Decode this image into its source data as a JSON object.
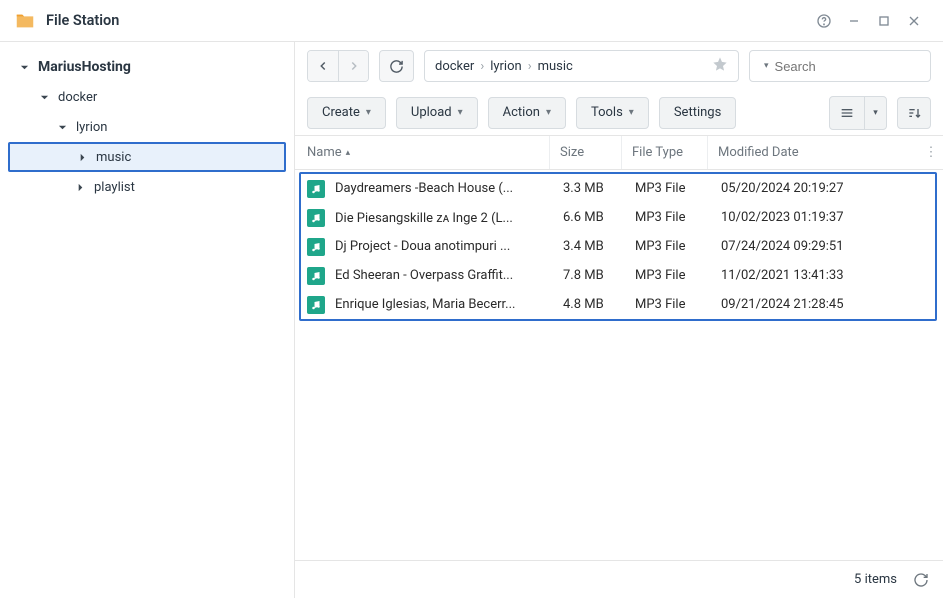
{
  "app": {
    "title": "File Station"
  },
  "tree": {
    "root": "MariusHosting",
    "items": [
      {
        "label": "docker",
        "depth": 1,
        "expanded": true
      },
      {
        "label": "lyrion",
        "depth": 2,
        "expanded": true
      },
      {
        "label": "music",
        "depth": 3,
        "expanded": false,
        "selected": true
      },
      {
        "label": "playlist",
        "depth": 3,
        "expanded": false
      }
    ]
  },
  "breadcrumb": [
    "docker",
    "lyrion",
    "music"
  ],
  "search": {
    "placeholder": "Search"
  },
  "toolbar": {
    "create": "Create",
    "upload": "Upload",
    "action": "Action",
    "tools": "Tools",
    "settings": "Settings"
  },
  "columns": {
    "name": "Name",
    "size": "Size",
    "type": "File Type",
    "date": "Modified Date"
  },
  "files": [
    {
      "name": "Daydreamers -Beach House (...",
      "size": "3.3 MB",
      "type": "MP3 File",
      "date": "05/20/2024 20:19:27"
    },
    {
      "name": "Die Piesangskille ᴢᴀ Inge 2 (L...",
      "size": "6.6 MB",
      "type": "MP3 File",
      "date": "10/02/2023 01:19:37"
    },
    {
      "name": "Dj Project - Doua anotimpuri ...",
      "size": "3.4 MB",
      "type": "MP3 File",
      "date": "07/24/2024 09:29:51"
    },
    {
      "name": "Ed Sheeran - Overpass Graffit...",
      "size": "7.8 MB",
      "type": "MP3 File",
      "date": "11/02/2021 13:41:33"
    },
    {
      "name": "Enrique Iglesias, Maria Becerr...",
      "size": "4.8 MB",
      "type": "MP3 File",
      "date": "09/21/2024 21:28:45"
    }
  ],
  "status": {
    "count": "5 items"
  }
}
